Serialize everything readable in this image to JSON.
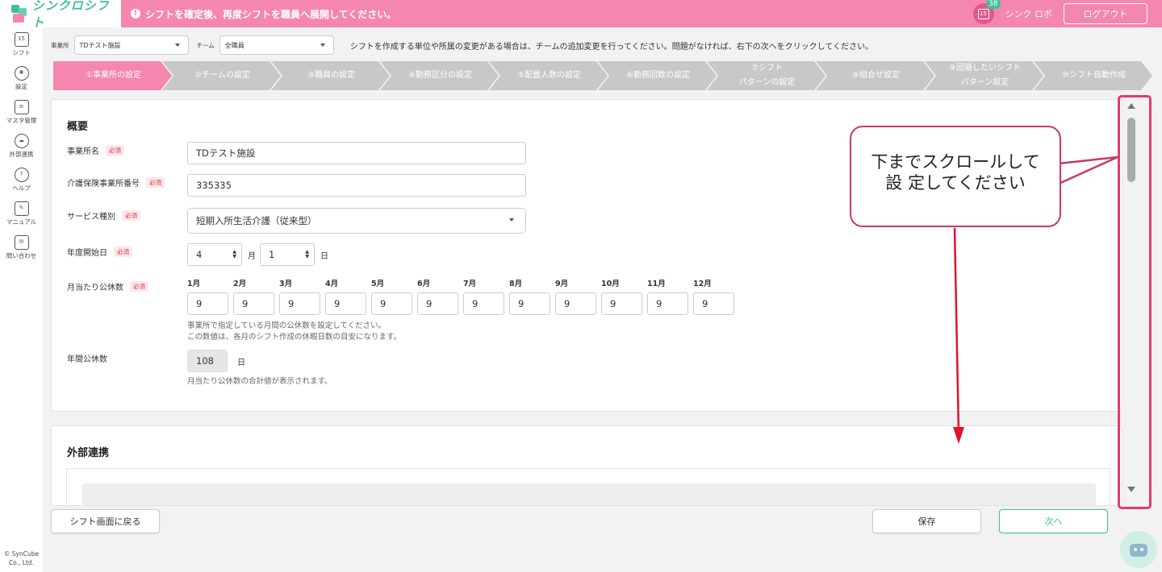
{
  "header": {
    "logo_text": "シンクロシフト",
    "notice": "シフトを確定後、再度シフトを職員へ展開してください。",
    "calendar_day": "15",
    "calendar_badge": "38",
    "user_name": "シンク ロボ",
    "logout_label": "ログアウト"
  },
  "sidebar": {
    "items": [
      {
        "label": "シフト",
        "icon": "calendar-icon",
        "glyph": "15"
      },
      {
        "label": "設定",
        "icon": "gear-icon",
        "glyph": "✺"
      },
      {
        "label": "マスタ管理",
        "icon": "database-icon",
        "glyph": "≡"
      },
      {
        "label": "外部連携",
        "icon": "cloud-icon",
        "glyph": "☁"
      },
      {
        "label": "ヘルプ",
        "icon": "help-icon",
        "glyph": "?"
      },
      {
        "label": "マニュアル",
        "icon": "edit-icon",
        "glyph": "✎"
      },
      {
        "label": "問い合わせ",
        "icon": "mail-icon",
        "glyph": "✉"
      }
    ],
    "copyright": "© SynCube Co., Ltd."
  },
  "filters": {
    "office_label": "事業所",
    "office_value": "TDテスト施設",
    "team_label": "チーム",
    "team_value": "全職員",
    "info": "シフトを作成する単位や所属の変更がある場合は、チームの追加変更を行ってください。問題がなければ、右下の次へをクリックしてください。"
  },
  "steps": [
    {
      "line1": "①事業所の設定",
      "line2": "",
      "active": true
    },
    {
      "line1": "②チームの設定",
      "line2": "",
      "active": false
    },
    {
      "line1": "③職員の設定",
      "line2": "",
      "active": false
    },
    {
      "line1": "④勤務区分の設定",
      "line2": "",
      "active": false
    },
    {
      "line1": "⑤配置人数の設定",
      "line2": "",
      "active": false
    },
    {
      "line1": "⑥勤務回数の設定",
      "line2": "",
      "active": false
    },
    {
      "line1": "⑦シフト",
      "line2": "パターンの設定",
      "active": false
    },
    {
      "line1": "⑧組合せ設定",
      "line2": "",
      "active": false
    },
    {
      "line1": "⑨回避したいシフト",
      "line2": "パターン設定",
      "active": false
    },
    {
      "line1": "⑩シフト自動作成",
      "line2": "",
      "active": false
    }
  ],
  "colors": {
    "accent": "#f586b0",
    "step_inactive": "#c8c8c8",
    "green": "#3fbf9a",
    "callout": "#c9376a",
    "highlight": "#e8386e"
  },
  "overview": {
    "title": "概要",
    "required": "必須",
    "office_name_label": "事業所名",
    "office_name_value": "TDテスト施設",
    "care_no_label": "介護保険事業所番号",
    "care_no_value": "335335",
    "service_label": "サービス種別",
    "service_value": "短期入所生活介護（従来型）",
    "year_start_label": "年度開始日",
    "year_start_month": "4",
    "month_unit": "月",
    "year_start_day": "1",
    "day_unit": "日",
    "holidays_label": "月当たり公休数",
    "months": [
      {
        "label": "1月",
        "value": "9"
      },
      {
        "label": "2月",
        "value": "9"
      },
      {
        "label": "3月",
        "value": "9"
      },
      {
        "label": "4月",
        "value": "9"
      },
      {
        "label": "5月",
        "value": "9"
      },
      {
        "label": "6月",
        "value": "9"
      },
      {
        "label": "7月",
        "value": "9"
      },
      {
        "label": "8月",
        "value": "9"
      },
      {
        "label": "9月",
        "value": "9"
      },
      {
        "label": "10月",
        "value": "9"
      },
      {
        "label": "11月",
        "value": "9"
      },
      {
        "label": "12月",
        "value": "9"
      }
    ],
    "holidays_help1": "事業所で指定している月間の公休数を設定してください。",
    "holidays_help2": "この数値は、各月のシフト作成の休暇日数の目安になります。",
    "annual_label": "年間公休数",
    "annual_value": "108",
    "annual_unit": "日",
    "annual_help": "月当たり公休数の合計値が表示されます。"
  },
  "external": {
    "title": "外部連携"
  },
  "callout": {
    "line1": "下までスクロールして",
    "line2": "設 定してください"
  },
  "footer": {
    "back_label": "シフト画面に戻る",
    "save_label": "保存",
    "next_label": "次へ"
  }
}
